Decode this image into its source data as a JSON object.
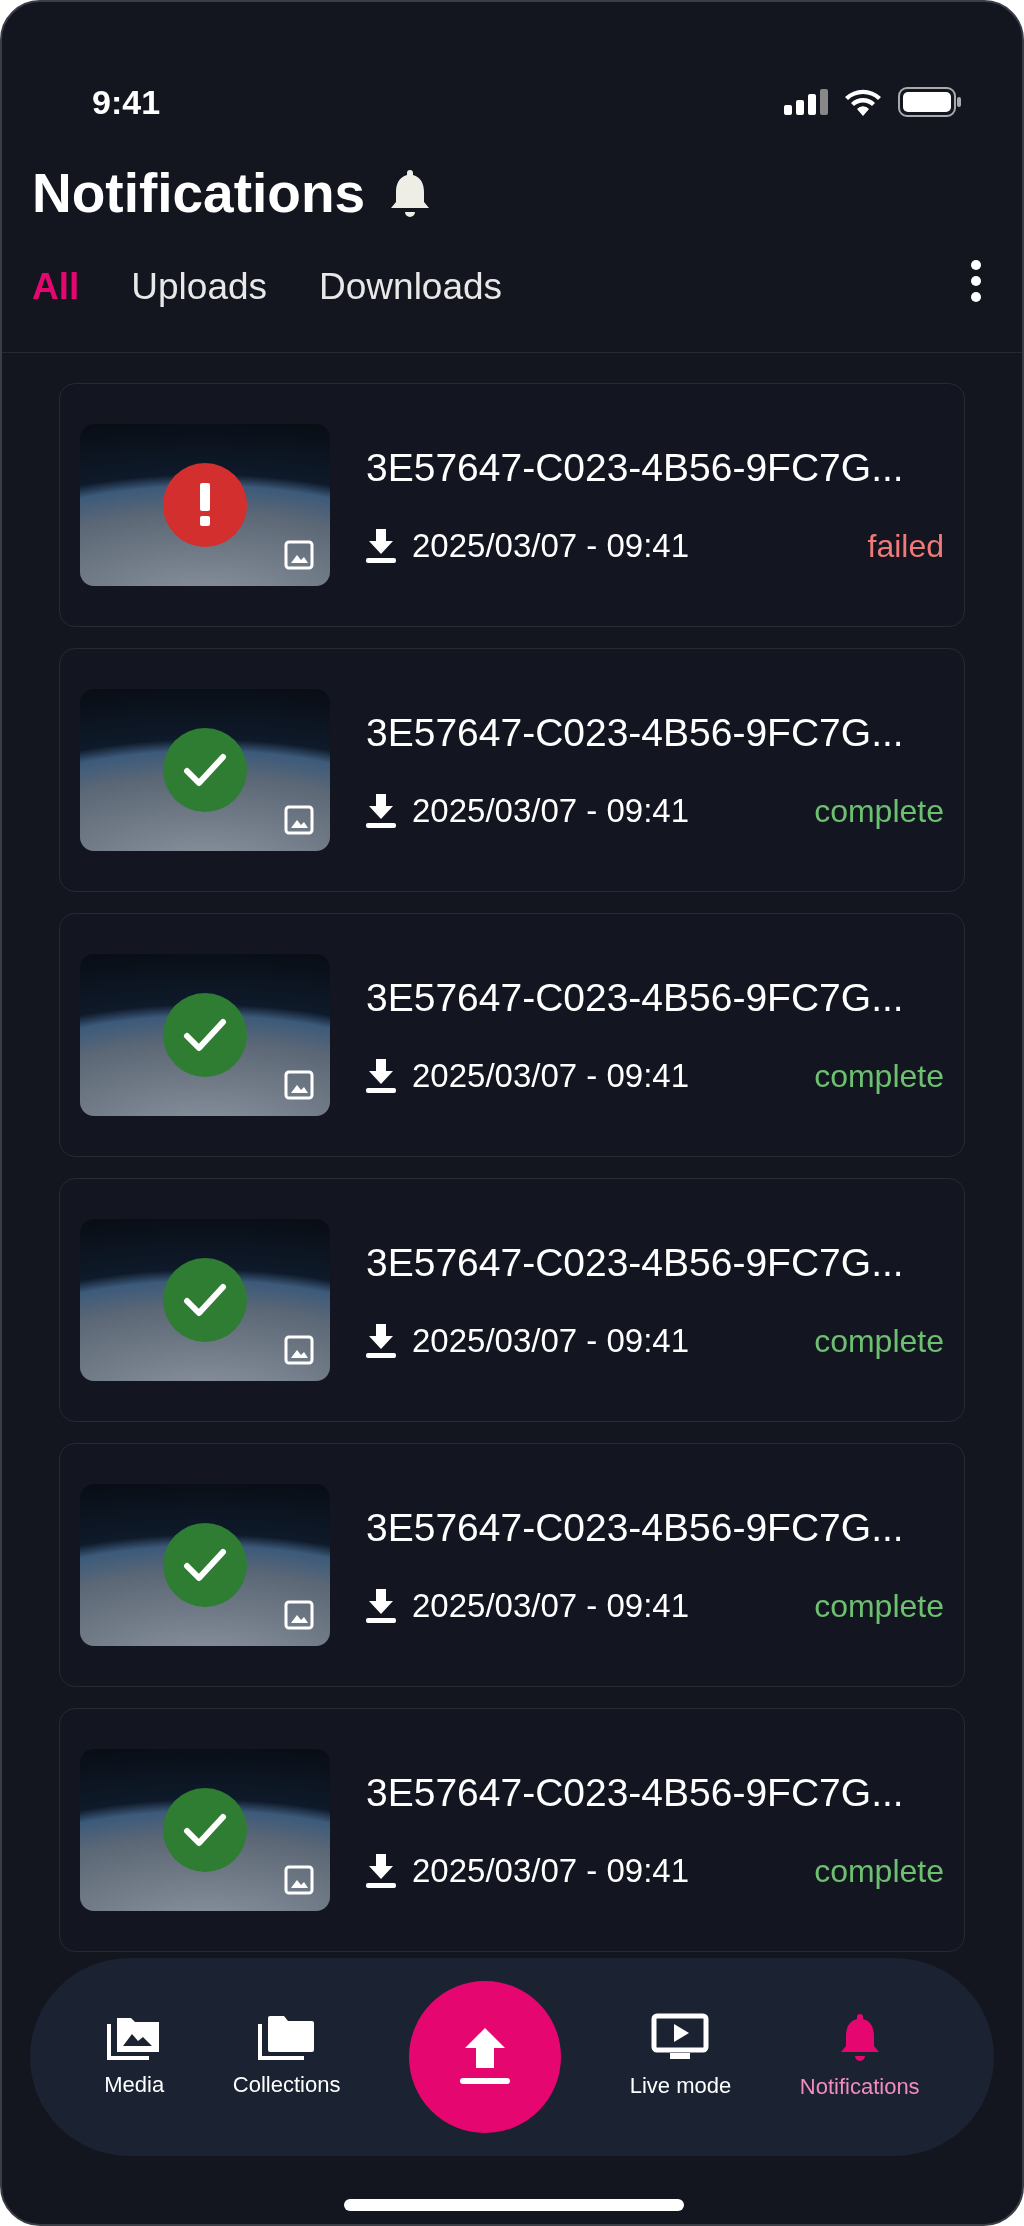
{
  "status_bar": {
    "time": "9:41"
  },
  "header": {
    "title": "Notifications"
  },
  "tabs": [
    {
      "label": "All",
      "selected": true
    },
    {
      "label": "Uploads",
      "selected": false
    },
    {
      "label": "Downloads",
      "selected": false
    }
  ],
  "notifications": [
    {
      "name": "3E57647-C023-4B56-9FC7G...",
      "date": "2025/03/07 - 09:41",
      "status": "failed",
      "kind": "failed"
    },
    {
      "name": "3E57647-C023-4B56-9FC7G...",
      "date": "2025/03/07 - 09:41",
      "status": "complete",
      "kind": "complete"
    },
    {
      "name": "3E57647-C023-4B56-9FC7G...",
      "date": "2025/03/07 - 09:41",
      "status": "complete",
      "kind": "complete"
    },
    {
      "name": "3E57647-C023-4B56-9FC7G...",
      "date": "2025/03/07 - 09:41",
      "status": "complete",
      "kind": "complete"
    },
    {
      "name": "3E57647-C023-4B56-9FC7G...",
      "date": "2025/03/07 - 09:41",
      "status": "complete",
      "kind": "complete"
    },
    {
      "name": "3E57647-C023-4B56-9FC7G...",
      "date": "2025/03/07 - 09:41",
      "status": "complete",
      "kind": "complete"
    }
  ],
  "bottom_nav": [
    {
      "label": "Media",
      "kind": "media",
      "selected": false
    },
    {
      "label": "Collections",
      "kind": "collections",
      "selected": false
    },
    {
      "kind": "upload",
      "selected": false
    },
    {
      "label": "Live mode",
      "kind": "live",
      "selected": false
    },
    {
      "label": "Notifications",
      "kind": "notifications",
      "selected": true
    }
  ]
}
